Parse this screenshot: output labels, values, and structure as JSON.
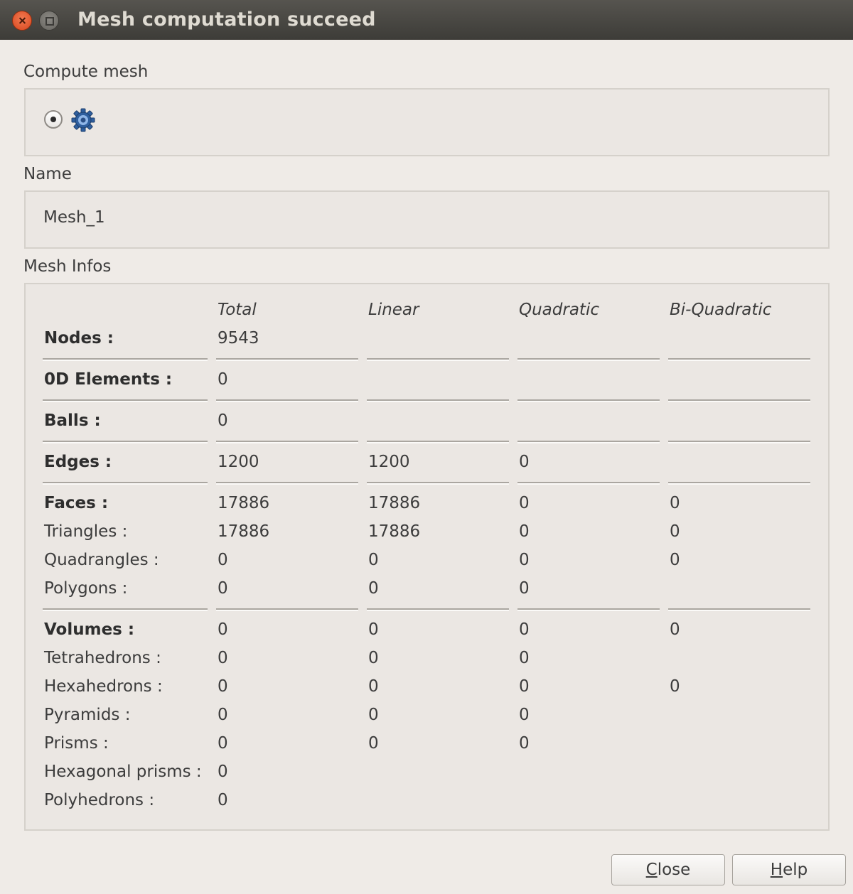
{
  "window": {
    "title": "Mesh computation succeed"
  },
  "compute_mesh": {
    "label": "Compute mesh",
    "icon": "gear-icon"
  },
  "name_section": {
    "label": "Name",
    "value": "Mesh_1"
  },
  "mesh_infos": {
    "label": "Mesh Infos",
    "headers": [
      "Total",
      "Linear",
      "Quadratic",
      "Bi-Quadratic"
    ],
    "rows": [
      {
        "label": "Nodes :",
        "bold": true,
        "values": [
          "9543",
          "",
          "",
          ""
        ]
      },
      {
        "label": "0D Elements :",
        "bold": true,
        "values": [
          "0",
          "",
          "",
          ""
        ]
      },
      {
        "label": "Balls :",
        "bold": true,
        "values": [
          "0",
          "",
          "",
          ""
        ]
      },
      {
        "label": "Edges :",
        "bold": true,
        "values": [
          "1200",
          "1200",
          "0",
          ""
        ]
      },
      {
        "label": "Faces :",
        "bold": true,
        "values": [
          "17886",
          "17886",
          "0",
          "0"
        ]
      },
      {
        "label": "Triangles :",
        "bold": false,
        "values": [
          "17886",
          "17886",
          "0",
          "0"
        ]
      },
      {
        "label": "Quadrangles :",
        "bold": false,
        "values": [
          "0",
          "0",
          "0",
          "0"
        ]
      },
      {
        "label": "Polygons :",
        "bold": false,
        "values": [
          "0",
          "0",
          "0",
          ""
        ]
      },
      {
        "label": "Volumes :",
        "bold": true,
        "values": [
          "0",
          "0",
          "0",
          "0"
        ]
      },
      {
        "label": "Tetrahedrons :",
        "bold": false,
        "values": [
          "0",
          "0",
          "0",
          ""
        ]
      },
      {
        "label": "Hexahedrons :",
        "bold": false,
        "values": [
          "0",
          "0",
          "0",
          "0"
        ]
      },
      {
        "label": "Pyramids :",
        "bold": false,
        "values": [
          "0",
          "0",
          "0",
          ""
        ]
      },
      {
        "label": "Prisms :",
        "bold": false,
        "values": [
          "0",
          "0",
          "0",
          ""
        ]
      },
      {
        "label": "Hexagonal prisms :",
        "bold": false,
        "values": [
          "0",
          "",
          "",
          ""
        ]
      },
      {
        "label": "Polyhedrons :",
        "bold": false,
        "values": [
          "0",
          "",
          "",
          ""
        ]
      }
    ]
  },
  "buttons": {
    "close": {
      "mnemonic": "C",
      "rest": "lose"
    },
    "help": {
      "mnemonic": "H",
      "rest": "elp"
    }
  }
}
